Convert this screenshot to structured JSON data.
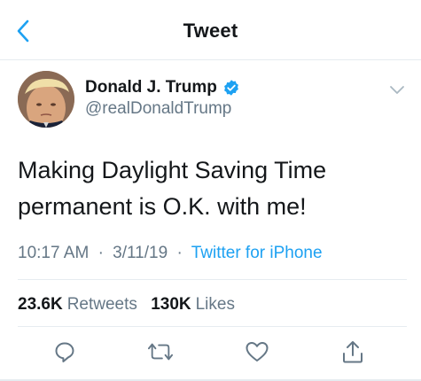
{
  "header": {
    "title": "Tweet",
    "back_icon": "chevron-left-icon"
  },
  "author": {
    "name": "Donald J. Trump",
    "handle": "@realDonaldTrump",
    "verified": true,
    "verified_icon": "verified-badge-icon",
    "menu_icon": "chevron-down-icon"
  },
  "tweet": {
    "text": "Making Daylight Saving Time\npermanent is O.K. with me!",
    "time": "10:17 AM",
    "separator": "·",
    "date": "3/11/19",
    "source": "Twitter for iPhone"
  },
  "stats": {
    "retweets_count": "23.6K",
    "retweets_label": "Retweets",
    "likes_count": "130K",
    "likes_label": "Likes"
  },
  "actions": [
    "reply-icon",
    "retweet-icon",
    "like-icon",
    "share-icon"
  ],
  "colors": {
    "accent": "#1da1f2",
    "primary_text": "#14171a",
    "secondary_text": "#657786",
    "divider": "#e6ecf0"
  }
}
